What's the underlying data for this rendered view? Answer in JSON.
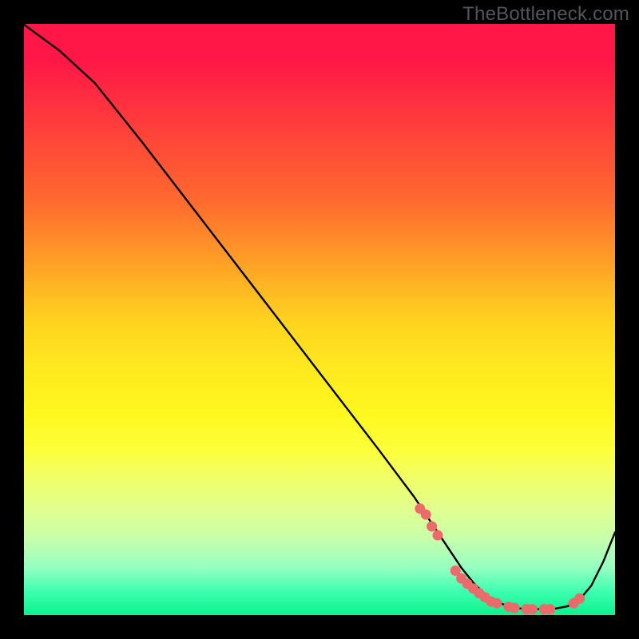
{
  "watermark": "TheBottleneck.com",
  "colors": {
    "dot": "#ec6a6a",
    "curve": "#000000"
  },
  "chart_data": {
    "type": "line",
    "title": "",
    "xlabel": "",
    "ylabel": "",
    "xlim": [
      0,
      100
    ],
    "ylim": [
      0,
      100
    ],
    "grid": false,
    "legend": false,
    "series": [
      {
        "name": "curve",
        "x": [
          0,
          6,
          12,
          20,
          30,
          40,
          50,
          60,
          66,
          70,
          72,
          74,
          76,
          78,
          80,
          82,
          84,
          86,
          88,
          90,
          92,
          94,
          96,
          98,
          100
        ],
        "y": [
          99.9,
          95.5,
          90,
          80,
          67,
          54,
          41,
          28,
          20,
          14,
          11,
          8,
          5.5,
          3.5,
          2.2,
          1.5,
          1.1,
          1.0,
          1.0,
          1.1,
          1.5,
          2.6,
          5.0,
          9.0,
          14.0
        ]
      }
    ],
    "marked_points": {
      "x": [
        67,
        68,
        69,
        70,
        73,
        74,
        75,
        76,
        77,
        78,
        79,
        80,
        82,
        83,
        85,
        86,
        88,
        89,
        93,
        94
      ],
      "y": [
        18,
        17,
        15,
        13.5,
        7.5,
        6.2,
        5.3,
        4.5,
        3.7,
        3.0,
        2.3,
        2.0,
        1.4,
        1.2,
        1.0,
        1.0,
        1.0,
        1.0,
        2.0,
        2.8
      ]
    }
  }
}
